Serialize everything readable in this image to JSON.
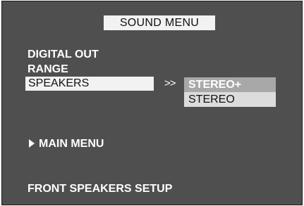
{
  "menu": {
    "title": "SOUND MENU",
    "items": [
      {
        "label": "DIGITAL OUT"
      },
      {
        "label": "RANGE"
      },
      {
        "label": "SPEAKERS"
      }
    ],
    "submenu_arrow": ">>",
    "speaker_options": [
      {
        "label": "STEREO+",
        "selected": true
      },
      {
        "label": "STEREO",
        "selected": false
      }
    ],
    "main_menu_label": "MAIN MENU",
    "footer_label": "FRONT SPEAKERS SETUP"
  },
  "colors": {
    "background": "#4f4f4f",
    "highlight_bar": "#f2f2f2",
    "selected_option": "#a8a8a8",
    "unselected_option": "#dcdcdc",
    "text": "#ffffff"
  }
}
